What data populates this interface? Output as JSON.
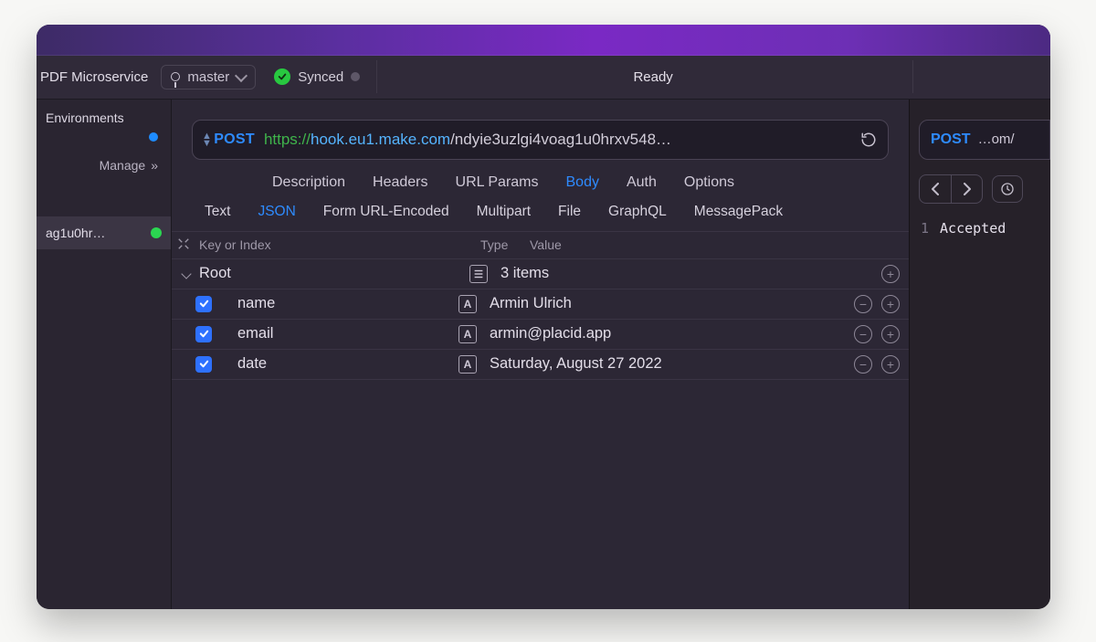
{
  "toolbar": {
    "project": "PDF Microservice",
    "branch": "master",
    "sync_label": "Synced",
    "status": "Ready"
  },
  "sidebar": {
    "header": "Environments",
    "manage_label": "Manage",
    "active_env_name": "ag1u0hr…"
  },
  "request": {
    "method": "POST",
    "url_scheme": "https://",
    "url_host": "hook.eu1.make.com",
    "url_path": "/ndyie3uzlgi4voag1u0hrxv548…",
    "tabs": {
      "description": "Description",
      "headers": "Headers",
      "url_params": "URL Params",
      "body": "Body",
      "auth": "Auth",
      "options": "Options"
    },
    "body_types": {
      "text": "Text",
      "json": "JSON",
      "form": "Form URL-Encoded",
      "multipart": "Multipart",
      "file": "File",
      "graphql": "GraphQL",
      "msgpack": "MessagePack"
    },
    "json_header": {
      "key": "Key or Index",
      "type": "Type",
      "value": "Value"
    },
    "json_root": {
      "label": "Root",
      "summary": "3 items"
    },
    "json_rows": [
      {
        "key": "name",
        "value": "Armin Ulrich"
      },
      {
        "key": "email",
        "value": "armin@placid.app"
      },
      {
        "key": "date",
        "value": "Saturday, August 27 2022"
      }
    ]
  },
  "response": {
    "method": "POST",
    "url_tail": "…om/",
    "line_no": "1",
    "body": "Accepted"
  }
}
